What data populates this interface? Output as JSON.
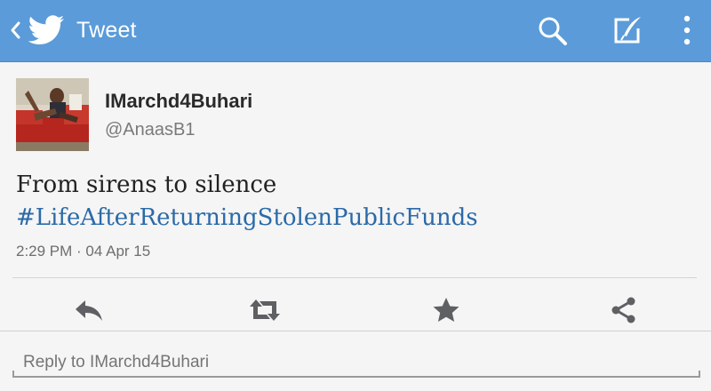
{
  "app_bar": {
    "title": "Tweet",
    "icons": [
      "back-chevron-icon",
      "twitter-bird-icon",
      "search-icon",
      "compose-icon",
      "overflow-menu-icon"
    ],
    "background_color": "#5b9bd9"
  },
  "tweet": {
    "display_name": "IMarchd4Buhari",
    "handle": "@AnaasB1",
    "text_line1": "From sirens to silence",
    "hashtag": "#LifeAfterReturningStolenPublicFunds",
    "timestamp": "2:29 PM · 04 Apr 15",
    "hashtag_color": "#2a6aa8"
  },
  "actions": {
    "icons": [
      "reply-icon",
      "retweet-icon",
      "favorite-icon",
      "share-icon"
    ]
  },
  "reply_box": {
    "placeholder": "Reply to IMarchd4Buhari"
  }
}
